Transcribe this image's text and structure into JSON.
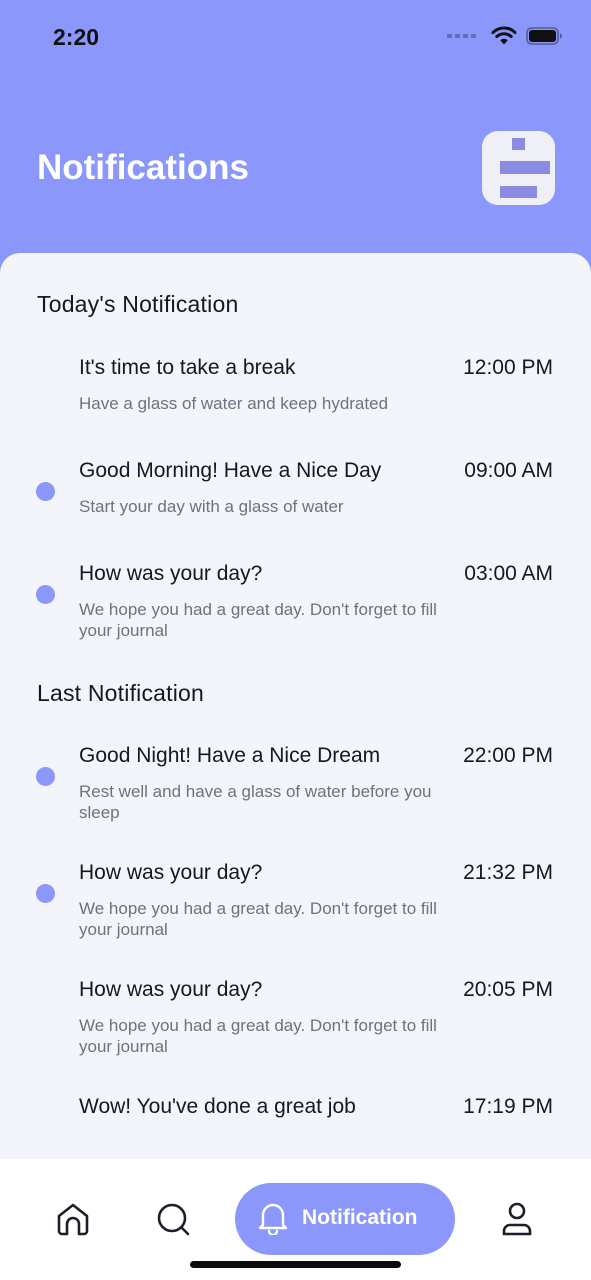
{
  "status_bar": {
    "time": "2:20"
  },
  "header": {
    "title": "Notifications"
  },
  "today": {
    "section_title": "Today's Notification",
    "items": [
      {
        "title": "It's time to take a break",
        "time": "12:00 PM",
        "description": "Have a glass of water and keep hydrated",
        "unread": false
      },
      {
        "title": "Good Morning! Have a Nice Day",
        "time": "09:00 AM",
        "description": "Start your day with a glass of water",
        "unread": true
      },
      {
        "title": "How was your day?",
        "time": "03:00 AM",
        "description": "We hope you had a great day. Don't forget to fill your journal",
        "unread": true
      }
    ]
  },
  "last": {
    "section_title": "Last Notification",
    "items": [
      {
        "title": "Good Night! Have a Nice Dream",
        "time": "22:00 PM",
        "description": "Rest well and have a glass of water before you sleep",
        "unread": true
      },
      {
        "title": "How was your day?",
        "time": "21:32 PM",
        "description": "We hope you had a great day. Don't forget to fill your journal",
        "unread": true
      },
      {
        "title": "How was your day?",
        "time": "20:05 PM",
        "description": "We hope you had a great day. Don't forget to fill your journal",
        "unread": false
      },
      {
        "title": "Wow! You've done a great job",
        "time": "17:19 PM",
        "description": "",
        "unread": false
      }
    ]
  },
  "tabbar": {
    "items": [
      {
        "icon": "home-icon"
      },
      {
        "icon": "search-icon"
      },
      {
        "icon": "bell-icon",
        "label": "Notification",
        "active": true
      },
      {
        "icon": "user-icon"
      }
    ]
  },
  "colors": {
    "accent": "#8b97fb",
    "sheet": "#f4f5fa",
    "tabbar": "#ffffff"
  }
}
